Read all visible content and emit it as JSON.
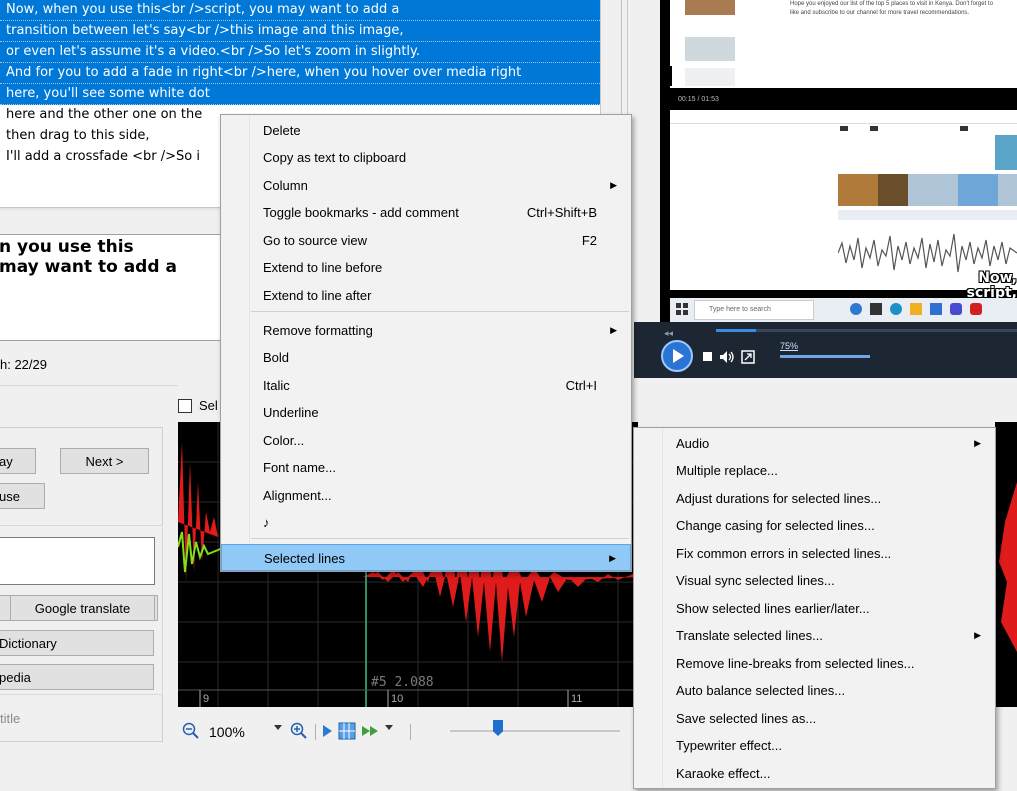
{
  "subtitle_list": {
    "rows": [
      {
        "text": "Now, when you use this<br />script, you may want to add a",
        "selected": true
      },
      {
        "text": "transition between let's say<br />this image and this image,",
        "selected": true
      },
      {
        "text": "or even let's assume it's a video.<br />So let's zoom in slightly.",
        "selected": true
      },
      {
        "text": "And for you to add a fade in right<br />here, when you hover over media right",
        "selected": true
      },
      {
        "text": "here, you'll see some white dot",
        "selected": true
      },
      {
        "text": "here and the other one on the",
        "selected": false
      },
      {
        "text": "then drag to this side,",
        "selected": false
      },
      {
        "text": "I'll add a crossfade <br />So i",
        "selected": false
      }
    ]
  },
  "editor": {
    "text_line1": "n you use this",
    "text_line2": "may want to add a",
    "length_label": "h: 22/29"
  },
  "left_panel": {
    "play_button": "ay",
    "next_button": "Next >",
    "pause_button": "use",
    "google_translate": "Google translate",
    "dictionary": "Dictionary",
    "wikipedia": "pedia",
    "title_label": "title"
  },
  "waveform": {
    "checkbox_label": "Sel",
    "marker_label": "#5  2.088",
    "tick_labels": [
      "9",
      "10",
      "11"
    ],
    "zoom_value": "100%"
  },
  "video": {
    "description_text": "Hope you enjoyed our list of the top 5 places to visit in Kenya. Don't forget to like and subscribe to our channel for more travel recommendations.",
    "timecode": "00:15 / 01:53",
    "caption_line1": "Now,",
    "caption_line2": "script, y",
    "search_placeholder": "Type here to search",
    "volume_value": "75%"
  },
  "context_menu": {
    "items": [
      {
        "label": "Delete",
        "shortcut": "",
        "submenu": false
      },
      {
        "label": "Copy as text to clipboard",
        "shortcut": "",
        "submenu": false
      },
      {
        "label": "Column",
        "shortcut": "",
        "submenu": true
      },
      {
        "label": "Toggle bookmarks - add comment",
        "shortcut": "Ctrl+Shift+B",
        "submenu": false
      },
      {
        "label": "Go to source view",
        "shortcut": "F2",
        "submenu": false
      },
      {
        "label": "Extend to line before",
        "shortcut": "",
        "submenu": false
      },
      {
        "label": "Extend to line after",
        "shortcut": "",
        "submenu": false
      },
      {
        "label": "Remove formatting",
        "shortcut": "",
        "submenu": true
      },
      {
        "label": "Bold",
        "shortcut": "",
        "submenu": false
      },
      {
        "label": "Italic",
        "shortcut": "Ctrl+I",
        "submenu": false
      },
      {
        "label": "Underline",
        "shortcut": "",
        "submenu": false
      },
      {
        "label": "Color...",
        "shortcut": "",
        "submenu": false
      },
      {
        "label": "Font name...",
        "shortcut": "",
        "submenu": false
      },
      {
        "label": "Alignment...",
        "shortcut": "",
        "submenu": false
      },
      {
        "label": "♪",
        "shortcut": "",
        "submenu": false
      },
      {
        "label": "Selected lines",
        "shortcut": "",
        "submenu": true
      }
    ]
  },
  "submenu": {
    "items": [
      {
        "label": "Audio",
        "submenu": true
      },
      {
        "label": "Multiple replace...",
        "submenu": false
      },
      {
        "label": "Adjust durations for selected lines...",
        "submenu": false
      },
      {
        "label": "Change casing for selected lines...",
        "submenu": false
      },
      {
        "label": "Fix common errors in selected lines...",
        "submenu": false
      },
      {
        "label": "Visual sync selected lines...",
        "submenu": false
      },
      {
        "label": "Show selected lines earlier/later...",
        "submenu": false
      },
      {
        "label": "Translate selected lines...",
        "submenu": true
      },
      {
        "label": "Remove line-breaks from selected lines...",
        "submenu": false
      },
      {
        "label": "Auto balance selected lines...",
        "submenu": false
      },
      {
        "label": "Save selected lines as...",
        "submenu": false
      },
      {
        "label": "Typewriter effect...",
        "submenu": false
      },
      {
        "label": "Karaoke effect...",
        "submenu": false
      }
    ]
  },
  "colors": {
    "selection": "#0078d7",
    "menu_highlight": "#90c8f6",
    "waveform_red": "#e01b1b",
    "waveform_green": "#7fe01b",
    "marker": "#3fbf7f"
  }
}
